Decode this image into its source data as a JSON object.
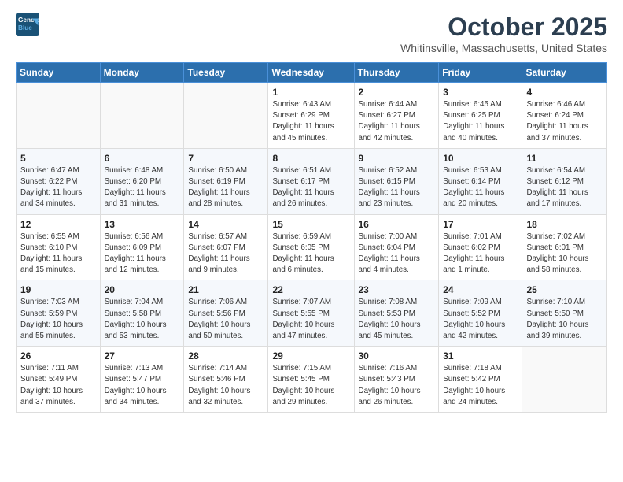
{
  "logo": {
    "line1": "General",
    "line2": "Blue"
  },
  "header": {
    "month": "October 2025",
    "location": "Whitinsville, Massachusetts, United States"
  },
  "weekdays": [
    "Sunday",
    "Monday",
    "Tuesday",
    "Wednesday",
    "Thursday",
    "Friday",
    "Saturday"
  ],
  "weeks": [
    [
      {
        "day": "",
        "info": ""
      },
      {
        "day": "",
        "info": ""
      },
      {
        "day": "",
        "info": ""
      },
      {
        "day": "1",
        "info": "Sunrise: 6:43 AM\nSunset: 6:29 PM\nDaylight: 11 hours\nand 45 minutes."
      },
      {
        "day": "2",
        "info": "Sunrise: 6:44 AM\nSunset: 6:27 PM\nDaylight: 11 hours\nand 42 minutes."
      },
      {
        "day": "3",
        "info": "Sunrise: 6:45 AM\nSunset: 6:25 PM\nDaylight: 11 hours\nand 40 minutes."
      },
      {
        "day": "4",
        "info": "Sunrise: 6:46 AM\nSunset: 6:24 PM\nDaylight: 11 hours\nand 37 minutes."
      }
    ],
    [
      {
        "day": "5",
        "info": "Sunrise: 6:47 AM\nSunset: 6:22 PM\nDaylight: 11 hours\nand 34 minutes."
      },
      {
        "day": "6",
        "info": "Sunrise: 6:48 AM\nSunset: 6:20 PM\nDaylight: 11 hours\nand 31 minutes."
      },
      {
        "day": "7",
        "info": "Sunrise: 6:50 AM\nSunset: 6:19 PM\nDaylight: 11 hours\nand 28 minutes."
      },
      {
        "day": "8",
        "info": "Sunrise: 6:51 AM\nSunset: 6:17 PM\nDaylight: 11 hours\nand 26 minutes."
      },
      {
        "day": "9",
        "info": "Sunrise: 6:52 AM\nSunset: 6:15 PM\nDaylight: 11 hours\nand 23 minutes."
      },
      {
        "day": "10",
        "info": "Sunrise: 6:53 AM\nSunset: 6:14 PM\nDaylight: 11 hours\nand 20 minutes."
      },
      {
        "day": "11",
        "info": "Sunrise: 6:54 AM\nSunset: 6:12 PM\nDaylight: 11 hours\nand 17 minutes."
      }
    ],
    [
      {
        "day": "12",
        "info": "Sunrise: 6:55 AM\nSunset: 6:10 PM\nDaylight: 11 hours\nand 15 minutes."
      },
      {
        "day": "13",
        "info": "Sunrise: 6:56 AM\nSunset: 6:09 PM\nDaylight: 11 hours\nand 12 minutes."
      },
      {
        "day": "14",
        "info": "Sunrise: 6:57 AM\nSunset: 6:07 PM\nDaylight: 11 hours\nand 9 minutes."
      },
      {
        "day": "15",
        "info": "Sunrise: 6:59 AM\nSunset: 6:05 PM\nDaylight: 11 hours\nand 6 minutes."
      },
      {
        "day": "16",
        "info": "Sunrise: 7:00 AM\nSunset: 6:04 PM\nDaylight: 11 hours\nand 4 minutes."
      },
      {
        "day": "17",
        "info": "Sunrise: 7:01 AM\nSunset: 6:02 PM\nDaylight: 11 hours\nand 1 minute."
      },
      {
        "day": "18",
        "info": "Sunrise: 7:02 AM\nSunset: 6:01 PM\nDaylight: 10 hours\nand 58 minutes."
      }
    ],
    [
      {
        "day": "19",
        "info": "Sunrise: 7:03 AM\nSunset: 5:59 PM\nDaylight: 10 hours\nand 55 minutes."
      },
      {
        "day": "20",
        "info": "Sunrise: 7:04 AM\nSunset: 5:58 PM\nDaylight: 10 hours\nand 53 minutes."
      },
      {
        "day": "21",
        "info": "Sunrise: 7:06 AM\nSunset: 5:56 PM\nDaylight: 10 hours\nand 50 minutes."
      },
      {
        "day": "22",
        "info": "Sunrise: 7:07 AM\nSunset: 5:55 PM\nDaylight: 10 hours\nand 47 minutes."
      },
      {
        "day": "23",
        "info": "Sunrise: 7:08 AM\nSunset: 5:53 PM\nDaylight: 10 hours\nand 45 minutes."
      },
      {
        "day": "24",
        "info": "Sunrise: 7:09 AM\nSunset: 5:52 PM\nDaylight: 10 hours\nand 42 minutes."
      },
      {
        "day": "25",
        "info": "Sunrise: 7:10 AM\nSunset: 5:50 PM\nDaylight: 10 hours\nand 39 minutes."
      }
    ],
    [
      {
        "day": "26",
        "info": "Sunrise: 7:11 AM\nSunset: 5:49 PM\nDaylight: 10 hours\nand 37 minutes."
      },
      {
        "day": "27",
        "info": "Sunrise: 7:13 AM\nSunset: 5:47 PM\nDaylight: 10 hours\nand 34 minutes."
      },
      {
        "day": "28",
        "info": "Sunrise: 7:14 AM\nSunset: 5:46 PM\nDaylight: 10 hours\nand 32 minutes."
      },
      {
        "day": "29",
        "info": "Sunrise: 7:15 AM\nSunset: 5:45 PM\nDaylight: 10 hours\nand 29 minutes."
      },
      {
        "day": "30",
        "info": "Sunrise: 7:16 AM\nSunset: 5:43 PM\nDaylight: 10 hours\nand 26 minutes."
      },
      {
        "day": "31",
        "info": "Sunrise: 7:18 AM\nSunset: 5:42 PM\nDaylight: 10 hours\nand 24 minutes."
      },
      {
        "day": "",
        "info": ""
      }
    ]
  ]
}
